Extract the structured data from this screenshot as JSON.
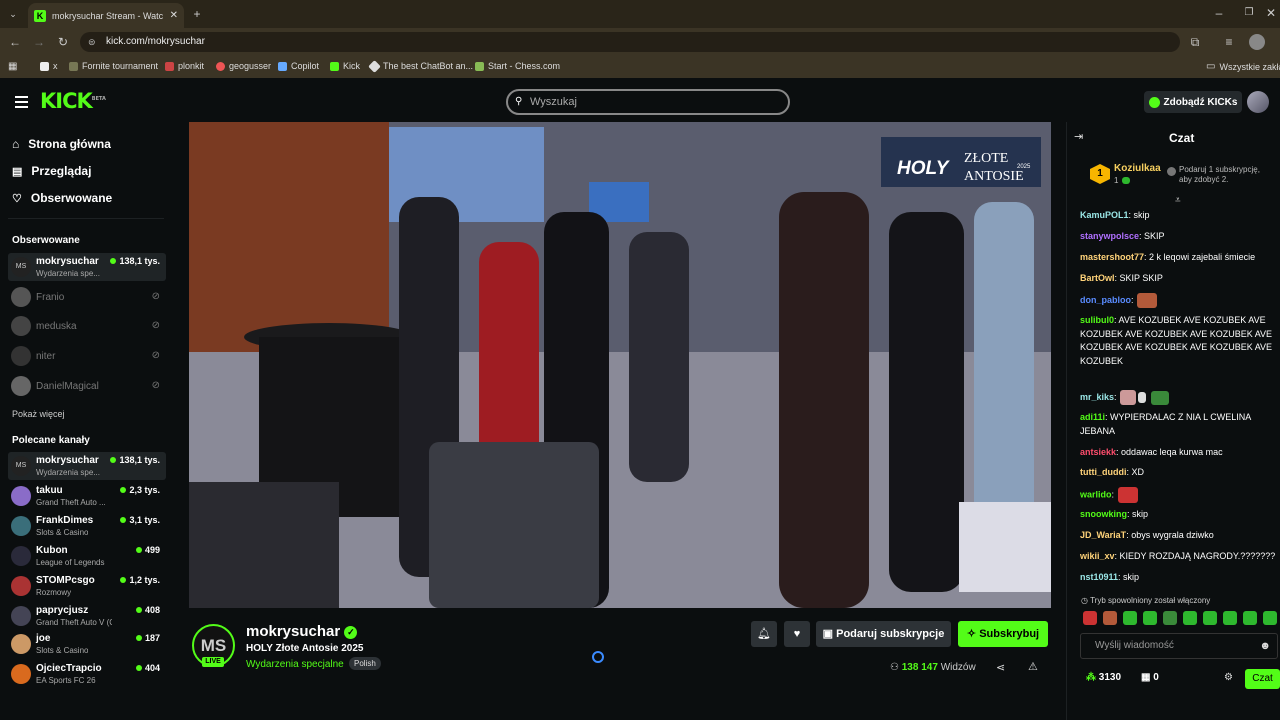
{
  "browser": {
    "tab_title": "mokrysuchar Stream - Watc",
    "url": "kick.com/mokrysuchar",
    "bookmarks": [
      "x",
      "Fornite tournament",
      "plonkit",
      "geogusser",
      "Copilot",
      "Kick",
      "The best ChatBot an...",
      "Start - Chess.com"
    ],
    "bookmarks_folder": "Wszystkie zakład"
  },
  "header": {
    "logo": "KICK",
    "logo_beta": "BETA",
    "search_placeholder": "Wyszukaj",
    "get_kicks": "Zdobądź KICKs"
  },
  "sidebar": {
    "nav": [
      "Strona główna",
      "Przeglądaj",
      "Obserwowane"
    ],
    "followed_title": "Obserwowane",
    "followed": [
      {
        "name": "mokrysuchar",
        "sub": "Wydarzenia spe...",
        "views": "138,1 tys.",
        "live": true
      },
      {
        "name": "Franio",
        "live": false
      },
      {
        "name": "meduska",
        "live": false
      },
      {
        "name": "niter",
        "live": false
      },
      {
        "name": "DanielMagical",
        "live": false
      }
    ],
    "show_more": "Pokaż więcej",
    "recommended_title": "Polecane kanały",
    "recommended": [
      {
        "name": "mokrysuchar",
        "sub": "Wydarzenia spe...",
        "views": "138,1 tys."
      },
      {
        "name": "takuu",
        "sub": "Grand Theft Auto ...",
        "views": "2,3 tys."
      },
      {
        "name": "FrankDimes",
        "sub": "Slots & Casino",
        "views": "3,1 tys."
      },
      {
        "name": "Kubon",
        "sub": "League of Legends",
        "views": "499"
      },
      {
        "name": "STOMPcsgo",
        "sub": "Rozmowy",
        "views": "1,2 tys."
      },
      {
        "name": "paprycjusz",
        "sub": "Grand Theft Auto V (G...",
        "views": "408"
      },
      {
        "name": "joe",
        "sub": "Slots & Casino",
        "views": "187"
      },
      {
        "name": "OjciecTrapcio",
        "sub": "EA Sports FC 26",
        "views": "404"
      }
    ]
  },
  "video": {
    "overlay_holy": "HOLY",
    "overlay_title_1": "ZŁOTE",
    "overlay_title_2": "ANTOSIE",
    "overlay_year": "2025"
  },
  "stream": {
    "avatar": "MS",
    "live": "LIVE",
    "name": "mokrysuchar",
    "title": "HOLY Złote Antosie 2025",
    "category": "Wydarzenia specjalne",
    "language": "Polish",
    "gift_label": "Podaruj subskrypcje",
    "subscribe_label": "Subskrybuj",
    "viewers_count": "138 147",
    "viewers_label": "Widzów"
  },
  "chat": {
    "title": "Czat",
    "pinned_user": "Koziulkaa",
    "pinned_count": "1",
    "pinned_text": "Podaruj 1 subskrypcję, aby zdobyć 2.",
    "messages": [
      {
        "user": "KamuPOL1",
        "color": "#9ae6e6",
        "text": "skip"
      },
      {
        "user": "stanywpolsce",
        "color": "#b070ff",
        "text": "SKIP"
      },
      {
        "user": "mastershoot77",
        "color": "#ffd37a",
        "text": "2 k leqowi zajebali śmiecie"
      },
      {
        "user": "BartOwl",
        "color": "#ffd37a",
        "text": "SKIP SKIP"
      },
      {
        "user": "don_pabloo",
        "color": "#5a8cff",
        "text": ""
      },
      {
        "user": "sulibul0",
        "color": "#53fc18",
        "text": "AVE KOZUBEK AVE KOZUBEK AVE KOZUBEK AVE KOZUBEK AVE KOZUBEK AVE KOZUBEK AVE KOZUBEK AVE KOZUBEK AVE KOZUBEK"
      },
      {
        "user": "mr_kiks",
        "color": "#9ae6e6",
        "text": ""
      },
      {
        "user": "adi11i",
        "color": "#53fc18",
        "text": "WYPIERDALAC Z NIA L CWELINA JEBANA"
      },
      {
        "user": "antsiekk",
        "color": "#ff4d6d",
        "text": "oddawac leqa kurwa mac"
      },
      {
        "user": "tutti_duddi",
        "color": "#ffd37a",
        "text": "XD"
      },
      {
        "user": "warlido",
        "color": "#53fc18",
        "text": ""
      },
      {
        "user": "snoowking",
        "color": "#53fc18",
        "text": "skip"
      },
      {
        "user": "JD_WariaT",
        "color": "#ffd37a",
        "text": "obys wygrala dziwko"
      },
      {
        "user": "wikii_xv",
        "color": "#ffd37a",
        "text": "KIEDY ROZDAJĄ NAGRODY.???????"
      },
      {
        "user": "nst10911",
        "color": "#9ae6e6",
        "text": "skip"
      }
    ],
    "slow_mode": "Tryb spowolniony został włączony",
    "input_placeholder": "Wyślij wiadomość",
    "points": "3130",
    "gifts": "0",
    "send_label": "Czat"
  },
  "colors": {
    "accent": "#53fc18",
    "bg": "#0b0e0f",
    "panel": "#2d3236"
  }
}
